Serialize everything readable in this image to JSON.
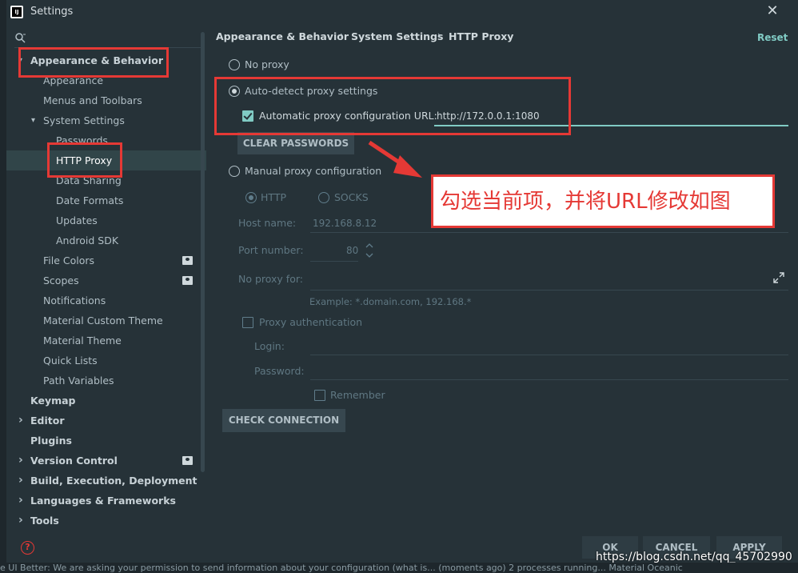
{
  "window": {
    "title": "Settings",
    "app_icon_text": "IJ"
  },
  "search": {
    "placeholder": ""
  },
  "sidebar": {
    "items": [
      {
        "label": "Appearance & Behavior",
        "level": 0,
        "bold": true,
        "expanded": true
      },
      {
        "label": "Appearance",
        "level": 1
      },
      {
        "label": "Menus and Toolbars",
        "level": 1
      },
      {
        "label": "System Settings",
        "level": 1,
        "expanded": true
      },
      {
        "label": "Passwords",
        "level": 2
      },
      {
        "label": "HTTP Proxy",
        "level": 2,
        "selected": true
      },
      {
        "label": "Data Sharing",
        "level": 2
      },
      {
        "label": "Date Formats",
        "level": 2
      },
      {
        "label": "Updates",
        "level": 2
      },
      {
        "label": "Android SDK",
        "level": 2
      },
      {
        "label": "File Colors",
        "level": 1,
        "badge": true
      },
      {
        "label": "Scopes",
        "level": 1,
        "badge": true
      },
      {
        "label": "Notifications",
        "level": 1
      },
      {
        "label": "Material Custom Theme",
        "level": 1
      },
      {
        "label": "Material Theme",
        "level": 1
      },
      {
        "label": "Quick Lists",
        "level": 1
      },
      {
        "label": "Path Variables",
        "level": 1
      },
      {
        "label": "Keymap",
        "level": 0,
        "bold": true
      },
      {
        "label": "Editor",
        "level": 0,
        "bold": true,
        "collapsed": true
      },
      {
        "label": "Plugins",
        "level": 0,
        "bold": true
      },
      {
        "label": "Version Control",
        "level": 0,
        "bold": true,
        "collapsed": true,
        "badge": true
      },
      {
        "label": "Build, Execution, Deployment",
        "level": 0,
        "bold": true,
        "collapsed": true
      },
      {
        "label": "Languages & Frameworks",
        "level": 0,
        "bold": true,
        "collapsed": true
      },
      {
        "label": "Tools",
        "level": 0,
        "bold": true,
        "collapsed": true
      }
    ]
  },
  "breadcrumb": {
    "part1": "Appearance & Behavior",
    "part2": "System Settings",
    "part3": "HTTP Proxy",
    "separator": "›"
  },
  "reset_label": "Reset",
  "proxy": {
    "no_proxy_label": "No proxy",
    "auto_detect_label": "Auto-detect proxy settings",
    "auto_url_label": "Automatic proxy configuration URL:",
    "auto_url_value": "http://172.0.0.1:1080",
    "clear_passwords_label": "CLEAR PASSWORDS",
    "manual_label": "Manual proxy configuration",
    "http_label": "HTTP",
    "socks_label": "SOCKS",
    "host_label": "Host name:",
    "host_value": "192.168.8.12",
    "port_label": "Port number:",
    "port_value": "80",
    "no_proxy_for_label": "No proxy for:",
    "no_proxy_for_value": "",
    "example_text": "Example: *.domain.com, 192.168.*",
    "proxy_auth_label": "Proxy authentication",
    "login_label": "Login:",
    "password_label": "Password:",
    "remember_label": "Remember",
    "check_connection_label": "CHECK CONNECTION"
  },
  "annotation": {
    "text": "勾选当前项，并将URL修改如图",
    "color": "#e53935"
  },
  "footer": {
    "ok": "OK",
    "cancel": "CANCEL",
    "apply": "APPLY"
  },
  "watermark": "https://blog.csdn.net/qq_45702990",
  "status_bar": "e UI Better: We are asking your permission to send information about your configuration (what is... (moments ago)   2 processes running...   Material Oceanic",
  "colors": {
    "accent": "#80cbc4",
    "background": "#263238",
    "annotation": "#e53935"
  }
}
